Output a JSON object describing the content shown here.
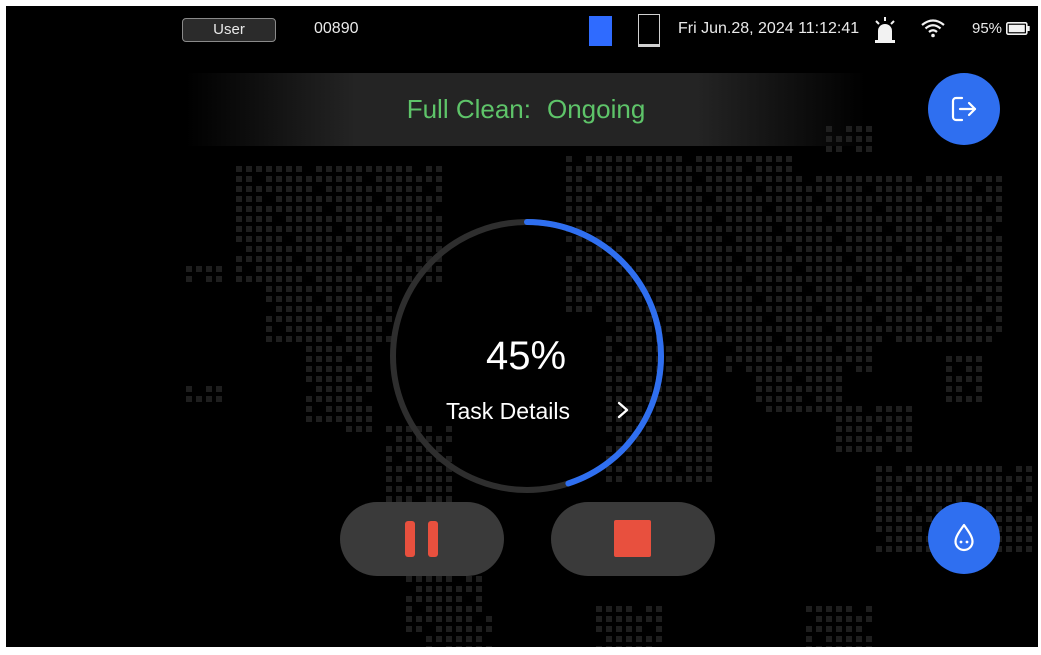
{
  "status_bar": {
    "user_label": "User",
    "device_id": "00890",
    "datetime": "Fri Jun.28, 2024 11:12:41",
    "battery_percent": "95%",
    "icons": [
      "blue-square-indicator",
      "outline-square-indicator",
      "alarm-light-icon",
      "wifi-icon",
      "battery-icon"
    ]
  },
  "banner": {
    "mode_label": "Full Clean:",
    "status_label": "Ongoing"
  },
  "progress": {
    "percent_text": "45%",
    "value": 0.45,
    "details_label": "Task Details",
    "details_icon": "chevron-right-icon"
  },
  "controls": {
    "exit_icon": "exit-icon",
    "pause_icon": "pause-icon",
    "stop_icon": "stop-icon",
    "water_icon": "water-drop-icon"
  },
  "colors": {
    "accent_blue": "#2f6ff0",
    "status_green": "#5ec469",
    "control_red": "#e8503e",
    "ring_track": "#2e2e2e",
    "background": "#000000"
  }
}
